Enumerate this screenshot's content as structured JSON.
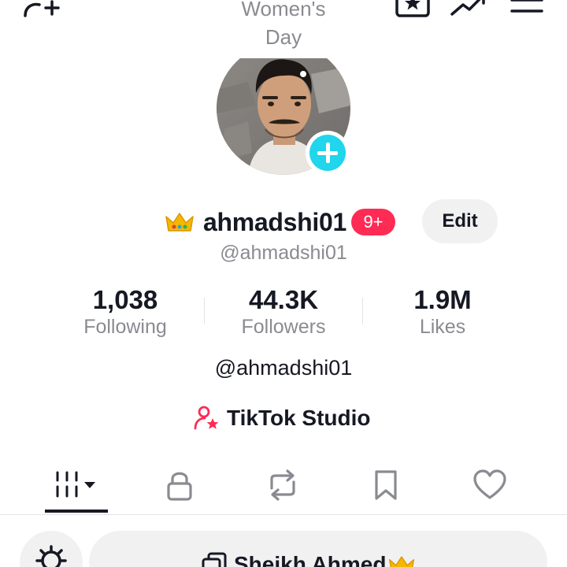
{
  "header": {
    "title_line1": "Women's",
    "title_line2": "Day",
    "icons": [
      "add-friend-icon",
      "star-icon",
      "analytics-icon",
      "menu-icon"
    ]
  },
  "profile": {
    "username": "ahmadshi01",
    "notification_badge": "9+",
    "edit_label": "Edit",
    "handle": "@ahmadshi01",
    "bio": "@ahmadshi01"
  },
  "stats": [
    {
      "value": "1,038",
      "label": "Following"
    },
    {
      "value": "44.3K",
      "label": "Followers"
    },
    {
      "value": "1.9M",
      "label": "Likes"
    }
  ],
  "studio": {
    "label": "TikTok Studio"
  },
  "tabs": [
    {
      "icon": "videos-grid-icon",
      "active": true
    },
    {
      "icon": "lock-icon",
      "active": false
    },
    {
      "icon": "repost-icon",
      "active": false
    },
    {
      "icon": "bookmark-icon",
      "active": false
    },
    {
      "icon": "heart-icon",
      "active": false
    }
  ],
  "bottom": {
    "profile_name": "Sheikh Ahmed"
  },
  "colors": {
    "accent_red": "#fe2c55",
    "accent_cyan": "#20d5ec",
    "text_primary": "#161823",
    "text_secondary": "#8a8b91",
    "button_gray": "#f1f1f2"
  }
}
